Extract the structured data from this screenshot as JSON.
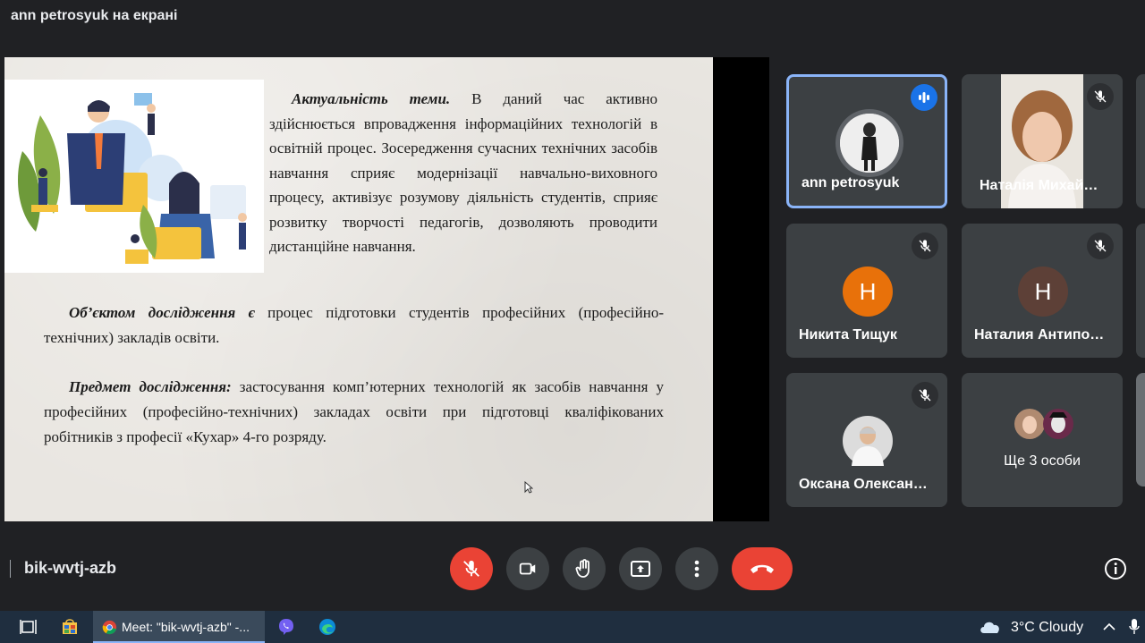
{
  "header": {
    "presenter_title": "ann petrosyuk на екрані"
  },
  "slide": {
    "p1_bold": "Актуальність теми.",
    "p1_text": " В даний час активно здійснюється впровадження інформаційних технологій в освітній процес. Зосередження сучасних технічних засобів навчання сприяє модернізації навчально-виховного процесу, активізує розумову діяльність студентів, сприяє розвитку творчості педагогів, дозволяють проводити дистанційне навчання.",
    "p2_bold": "Об’єктом дослідження є",
    "p2_text": " процес підготовки студентів професійних (професійно-технічних) закладів освіти.",
    "p3_bold": "Предмет дослідження:",
    "p3_text": " застосування комп’ютерних технологій як засобів навчання у професійних (професійно-технічних) закладах освіти при підготовці кваліфікованих робітників з професії «Кухар» 4-го розряду."
  },
  "participants": [
    {
      "name": "ann petrosyuk",
      "state": "speaking",
      "avatar": "photo"
    },
    {
      "name": "Наталія Михай…",
      "state": "muted",
      "avatar": "video"
    },
    {
      "name": "Никита Тищук",
      "state": "muted",
      "avatar": "letter",
      "letter": "Н",
      "color": "#e8710a"
    },
    {
      "name": "Наталия Антипо…",
      "state": "muted",
      "avatar": "letter",
      "letter": "Н",
      "color": "#5d4037"
    },
    {
      "name": "Оксана Олексан…",
      "state": "muted",
      "avatar": "photo"
    },
    {
      "name": "Ще 3 особи",
      "state": "none",
      "avatar": "group"
    }
  ],
  "footer": {
    "meeting_code": "bik-wvtj-azb"
  },
  "controls": [
    "mic-off-icon",
    "camera-icon",
    "raise-hand-icon",
    "present-icon",
    "more-icon",
    "hang-up-icon"
  ],
  "taskbar": {
    "active_task_label": "Meet: \"bik-wvtj-azb\" -...",
    "weather": "3°C  Cloudy"
  },
  "colors": {
    "accent": "#8ab4f8",
    "danger": "#ea4335",
    "tile": "#3c4043",
    "speaking": "#1a73e8"
  }
}
